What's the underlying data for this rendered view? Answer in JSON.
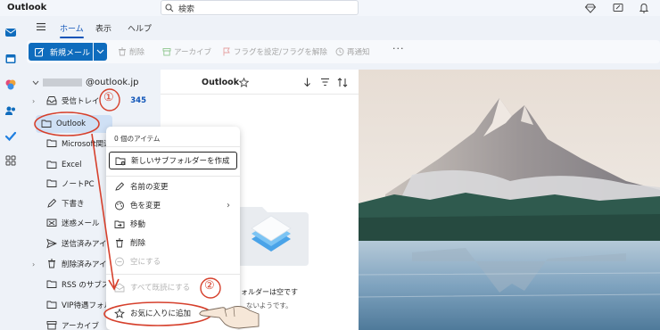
{
  "app": {
    "title": "Outlook"
  },
  "search": {
    "placeholder": "検索"
  },
  "ribbon": {
    "tabs": [
      {
        "label": "ホーム",
        "active": true
      },
      {
        "label": "表示",
        "active": false
      },
      {
        "label": "ヘルプ",
        "active": false
      }
    ]
  },
  "toolbar": {
    "new_mail": "新規メール",
    "delete": "削除",
    "archive": "アーカイブ",
    "flag": "フラグを設定/フラグを解除",
    "snooze": "再通知"
  },
  "account": {
    "email_suffix": "@outlook.jp"
  },
  "folders": [
    {
      "name": "受信トレイ",
      "count": "345",
      "icon": "inbox-icon"
    },
    {
      "name": "Outlook",
      "count": "",
      "icon": "folder-icon"
    },
    {
      "name": "Microsoft関連",
      "count": "",
      "icon": "folder-icon"
    },
    {
      "name": "Excel",
      "count": "",
      "icon": "folder-icon"
    },
    {
      "name": "ノートPC",
      "count": "",
      "icon": "folder-icon"
    },
    {
      "name": "下書き",
      "count": "",
      "icon": "pencil-icon"
    },
    {
      "name": "迷惑メール",
      "count": "",
      "icon": "junk-icon"
    },
    {
      "name": "送信済みアイテム",
      "count": "",
      "icon": "send-icon"
    },
    {
      "name": "削除済みアイテム",
      "count": "",
      "icon": "trash-icon"
    },
    {
      "name": "RSS のサブスクリプション",
      "count": "",
      "icon": "folder-icon"
    },
    {
      "name": "VIP待遇フォルダー",
      "count": "",
      "icon": "folder-icon"
    },
    {
      "name": "アーカイブ",
      "count": "",
      "icon": "archive-icon"
    }
  ],
  "list": {
    "title": "Outlook",
    "empty_line1": "フォルダーは空です",
    "empty_line2": "ないようです。"
  },
  "context_menu": {
    "header": "0 個のアイテム",
    "items": [
      {
        "label": "新しいサブフォルダーを作成",
        "icon": "new-folder-icon",
        "disabled": false
      },
      {
        "label": "名前の変更",
        "icon": "rename-icon",
        "disabled": false
      },
      {
        "label": "色を変更",
        "icon": "palette-icon",
        "disabled": false
      },
      {
        "label": "移動",
        "icon": "move-icon",
        "disabled": false
      },
      {
        "label": "削除",
        "icon": "trash-icon",
        "disabled": false
      },
      {
        "label": "空にする",
        "icon": "empty-icon",
        "disabled": true
      },
      {
        "label": "すべて既読にする",
        "icon": "mail-read-icon",
        "disabled": true
      },
      {
        "label": "お気に入りに追加",
        "icon": "star-icon",
        "disabled": false
      }
    ]
  },
  "annotations": {
    "step1": "①",
    "step2": "②"
  },
  "colors": {
    "accent": "#0f6cbd",
    "annotation_red": "#d6402c",
    "selected_bg": "#cfe0f5"
  }
}
